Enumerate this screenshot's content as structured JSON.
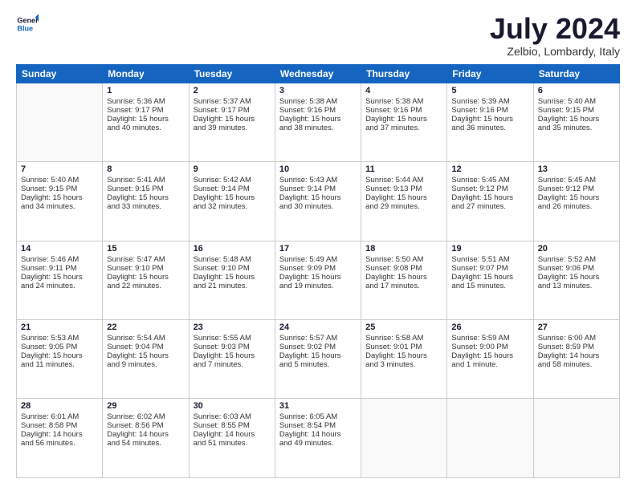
{
  "header": {
    "logo_line1": "General",
    "logo_line2": "Blue",
    "month_year": "July 2024",
    "location": "Zelbio, Lombardy, Italy"
  },
  "days_of_week": [
    "Sunday",
    "Monday",
    "Tuesday",
    "Wednesday",
    "Thursday",
    "Friday",
    "Saturday"
  ],
  "weeks": [
    [
      {
        "day": "",
        "content": ""
      },
      {
        "day": "1",
        "content": "Sunrise: 5:36 AM\nSunset: 9:17 PM\nDaylight: 15 hours\nand 40 minutes."
      },
      {
        "day": "2",
        "content": "Sunrise: 5:37 AM\nSunset: 9:17 PM\nDaylight: 15 hours\nand 39 minutes."
      },
      {
        "day": "3",
        "content": "Sunrise: 5:38 AM\nSunset: 9:16 PM\nDaylight: 15 hours\nand 38 minutes."
      },
      {
        "day": "4",
        "content": "Sunrise: 5:38 AM\nSunset: 9:16 PM\nDaylight: 15 hours\nand 37 minutes."
      },
      {
        "day": "5",
        "content": "Sunrise: 5:39 AM\nSunset: 9:16 PM\nDaylight: 15 hours\nand 36 minutes."
      },
      {
        "day": "6",
        "content": "Sunrise: 5:40 AM\nSunset: 9:15 PM\nDaylight: 15 hours\nand 35 minutes."
      }
    ],
    [
      {
        "day": "7",
        "content": "Sunrise: 5:40 AM\nSunset: 9:15 PM\nDaylight: 15 hours\nand 34 minutes."
      },
      {
        "day": "8",
        "content": "Sunrise: 5:41 AM\nSunset: 9:15 PM\nDaylight: 15 hours\nand 33 minutes."
      },
      {
        "day": "9",
        "content": "Sunrise: 5:42 AM\nSunset: 9:14 PM\nDaylight: 15 hours\nand 32 minutes."
      },
      {
        "day": "10",
        "content": "Sunrise: 5:43 AM\nSunset: 9:14 PM\nDaylight: 15 hours\nand 30 minutes."
      },
      {
        "day": "11",
        "content": "Sunrise: 5:44 AM\nSunset: 9:13 PM\nDaylight: 15 hours\nand 29 minutes."
      },
      {
        "day": "12",
        "content": "Sunrise: 5:45 AM\nSunset: 9:12 PM\nDaylight: 15 hours\nand 27 minutes."
      },
      {
        "day": "13",
        "content": "Sunrise: 5:45 AM\nSunset: 9:12 PM\nDaylight: 15 hours\nand 26 minutes."
      }
    ],
    [
      {
        "day": "14",
        "content": "Sunrise: 5:46 AM\nSunset: 9:11 PM\nDaylight: 15 hours\nand 24 minutes."
      },
      {
        "day": "15",
        "content": "Sunrise: 5:47 AM\nSunset: 9:10 PM\nDaylight: 15 hours\nand 22 minutes."
      },
      {
        "day": "16",
        "content": "Sunrise: 5:48 AM\nSunset: 9:10 PM\nDaylight: 15 hours\nand 21 minutes."
      },
      {
        "day": "17",
        "content": "Sunrise: 5:49 AM\nSunset: 9:09 PM\nDaylight: 15 hours\nand 19 minutes."
      },
      {
        "day": "18",
        "content": "Sunrise: 5:50 AM\nSunset: 9:08 PM\nDaylight: 15 hours\nand 17 minutes."
      },
      {
        "day": "19",
        "content": "Sunrise: 5:51 AM\nSunset: 9:07 PM\nDaylight: 15 hours\nand 15 minutes."
      },
      {
        "day": "20",
        "content": "Sunrise: 5:52 AM\nSunset: 9:06 PM\nDaylight: 15 hours\nand 13 minutes."
      }
    ],
    [
      {
        "day": "21",
        "content": "Sunrise: 5:53 AM\nSunset: 9:05 PM\nDaylight: 15 hours\nand 11 minutes."
      },
      {
        "day": "22",
        "content": "Sunrise: 5:54 AM\nSunset: 9:04 PM\nDaylight: 15 hours\nand 9 minutes."
      },
      {
        "day": "23",
        "content": "Sunrise: 5:55 AM\nSunset: 9:03 PM\nDaylight: 15 hours\nand 7 minutes."
      },
      {
        "day": "24",
        "content": "Sunrise: 5:57 AM\nSunset: 9:02 PM\nDaylight: 15 hours\nand 5 minutes."
      },
      {
        "day": "25",
        "content": "Sunrise: 5:58 AM\nSunset: 9:01 PM\nDaylight: 15 hours\nand 3 minutes."
      },
      {
        "day": "26",
        "content": "Sunrise: 5:59 AM\nSunset: 9:00 PM\nDaylight: 15 hours\nand 1 minute."
      },
      {
        "day": "27",
        "content": "Sunrise: 6:00 AM\nSunset: 8:59 PM\nDaylight: 14 hours\nand 58 minutes."
      }
    ],
    [
      {
        "day": "28",
        "content": "Sunrise: 6:01 AM\nSunset: 8:58 PM\nDaylight: 14 hours\nand 56 minutes."
      },
      {
        "day": "29",
        "content": "Sunrise: 6:02 AM\nSunset: 8:56 PM\nDaylight: 14 hours\nand 54 minutes."
      },
      {
        "day": "30",
        "content": "Sunrise: 6:03 AM\nSunset: 8:55 PM\nDaylight: 14 hours\nand 51 minutes."
      },
      {
        "day": "31",
        "content": "Sunrise: 6:05 AM\nSunset: 8:54 PM\nDaylight: 14 hours\nand 49 minutes."
      },
      {
        "day": "",
        "content": ""
      },
      {
        "day": "",
        "content": ""
      },
      {
        "day": "",
        "content": ""
      }
    ]
  ]
}
